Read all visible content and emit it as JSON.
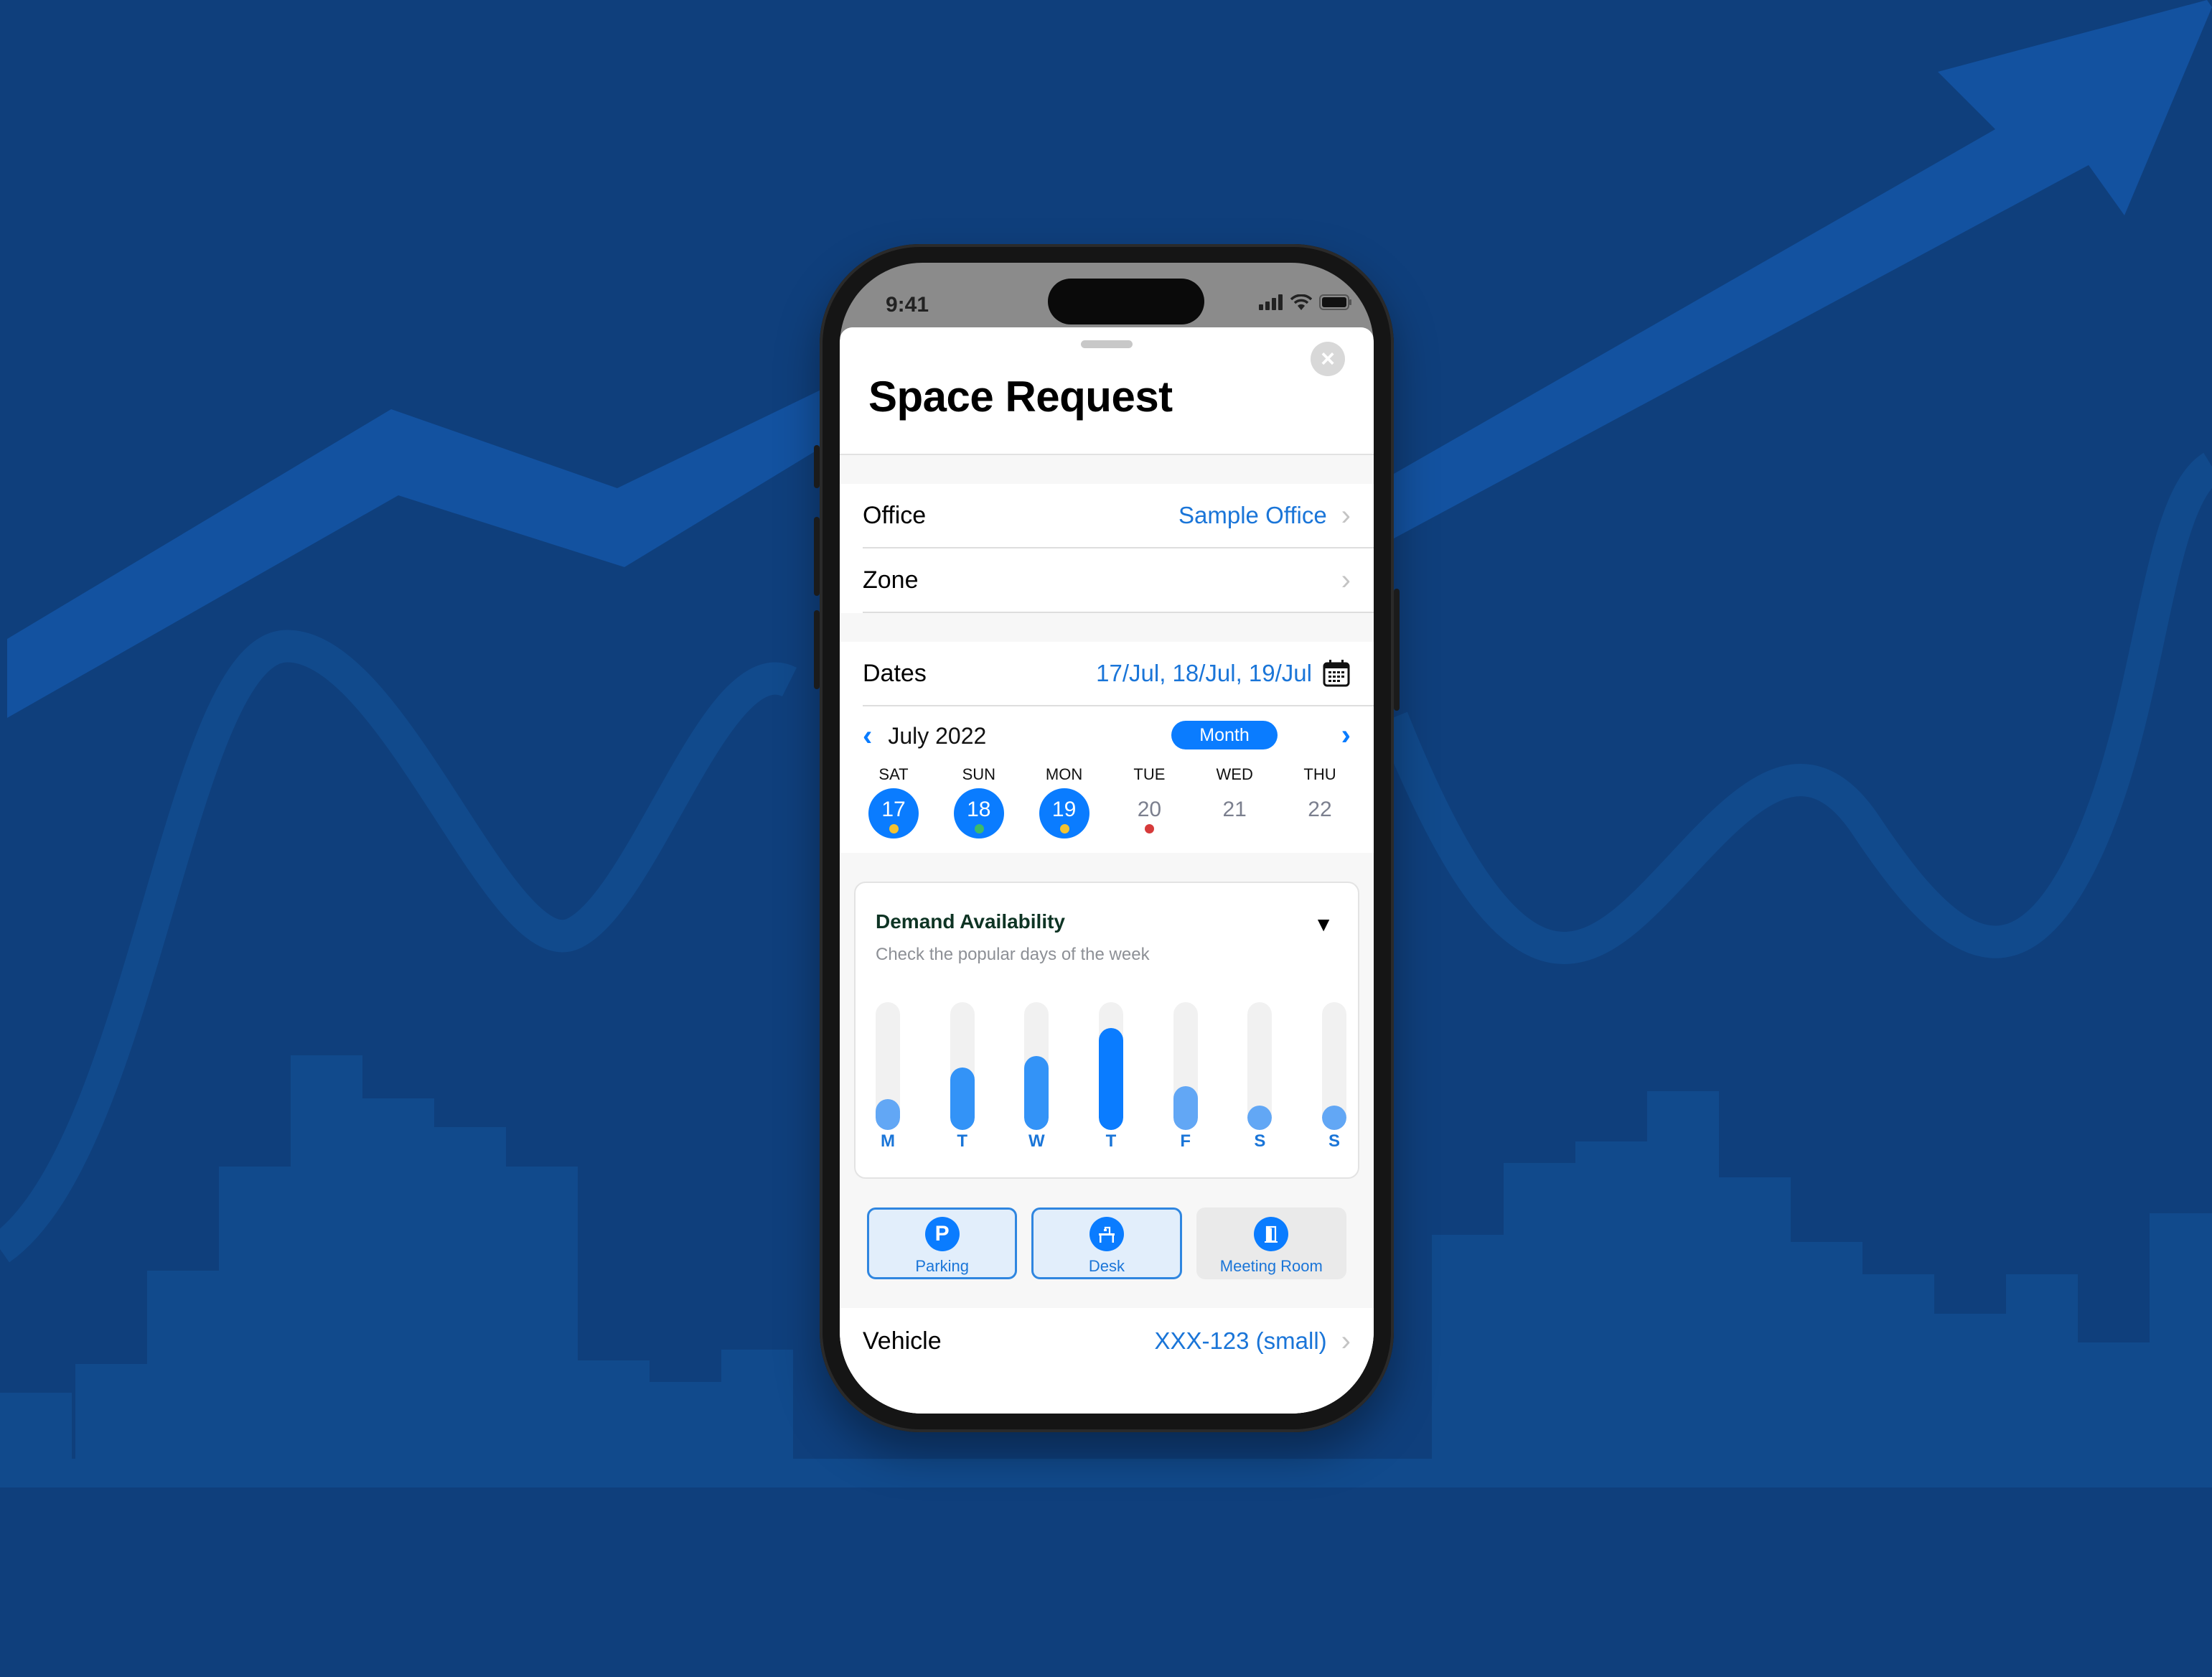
{
  "status_bar": {
    "time": "9:41"
  },
  "sheet": {
    "title": "Space Request",
    "close_icon": "close-icon"
  },
  "form": {
    "office": {
      "label": "Office",
      "value": "Sample Office"
    },
    "zone": {
      "label": "Zone",
      "value": ""
    },
    "dates": {
      "label": "Dates",
      "value": "17/Jul, 18/Jul, 19/Jul",
      "icon": "calendar-icon"
    }
  },
  "calendar": {
    "month_label": "July 2022",
    "view_toggle": "Month",
    "days": [
      {
        "name": "SAT",
        "num": "17",
        "selected": true,
        "dot": "#f5c330"
      },
      {
        "name": "SUN",
        "num": "18",
        "selected": true,
        "dot": "#3dba6a"
      },
      {
        "name": "MON",
        "num": "19",
        "selected": true,
        "dot": "#f5c330"
      },
      {
        "name": "TUE",
        "num": "20",
        "selected": false,
        "dot": "#d63a3a"
      },
      {
        "name": "WED",
        "num": "21",
        "selected": false,
        "dot": null
      },
      {
        "name": "THU",
        "num": "22",
        "selected": false,
        "dot": null
      }
    ]
  },
  "demand": {
    "title": "Demand Availability",
    "subtitle": "Check the popular days of the week",
    "toggle_glyph": "▼",
    "chart_data": {
      "type": "bar",
      "categories": [
        "M",
        "T",
        "W",
        "T",
        "F",
        "S",
        "S"
      ],
      "values": [
        24,
        49,
        58,
        80,
        34,
        17,
        17
      ],
      "ylim": [
        0,
        100
      ],
      "colors": [
        "#62a7f5",
        "#3393f7",
        "#3393f7",
        "#0a7cff",
        "#62a7f5",
        "#62a7f5",
        "#62a7f5"
      ]
    }
  },
  "space_types": [
    {
      "label": "Parking",
      "icon": "parking-icon",
      "glyph": "P",
      "active": true
    },
    {
      "label": "Desk",
      "icon": "desk-icon",
      "glyph": "",
      "active": true
    },
    {
      "label": "Meeting Room",
      "icon": "door-icon",
      "glyph": "",
      "active": false
    }
  ],
  "vehicle": {
    "label": "Vehicle",
    "value": "XXX-123 (small)"
  },
  "colors": {
    "accent": "#0a7cff",
    "link": "#1a75d8",
    "background": "#0f3f7c"
  }
}
